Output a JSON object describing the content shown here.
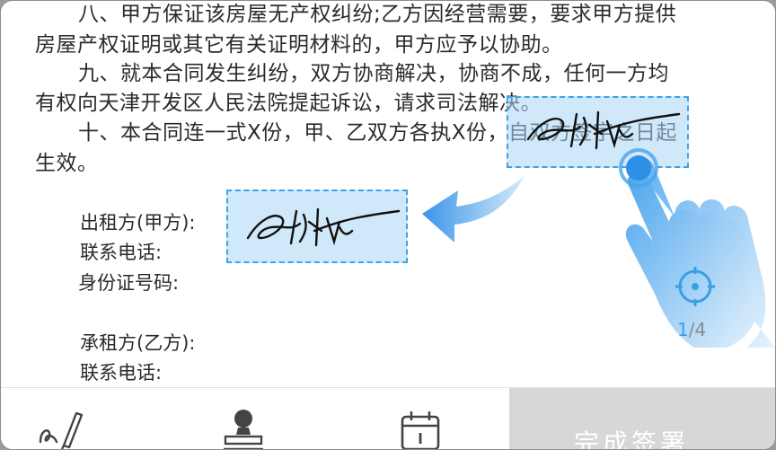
{
  "document": {
    "lines": [
      "八、甲方保证该房屋无产权纠纷;乙方因经营需要，要求甲方提供",
      "房屋产权证明或其它有关证明材料的，甲方应予以协助。",
      "九、就本合同发生纠纷，双方协商解决，协商不成，任何一方均",
      "有权向天津开发区人民法院提起诉讼，请求司法解决。",
      "十、本合同连一式X份，甲、乙双方各执X份，自双方签字之日起",
      "生效。"
    ],
    "fields": {
      "lessor": "出租方(甲方):",
      "lessor_phone": "联系电话:",
      "lessor_id": "身份证号码:",
      "lessee": "承租方(乙方):",
      "lessee_phone": "联系电话:"
    }
  },
  "pager": {
    "current": "1",
    "separator": "/",
    "total": "4"
  },
  "toolbar": {
    "finish_label": "完成签署",
    "tools": [
      "signature-tool-icon",
      "seal-stamp-icon",
      "date-calendar-icon"
    ]
  },
  "colors": {
    "accent": "#3a9fe0",
    "signature_box_fill": "#c4e2f6",
    "finish_button": "#d7d7d7"
  }
}
